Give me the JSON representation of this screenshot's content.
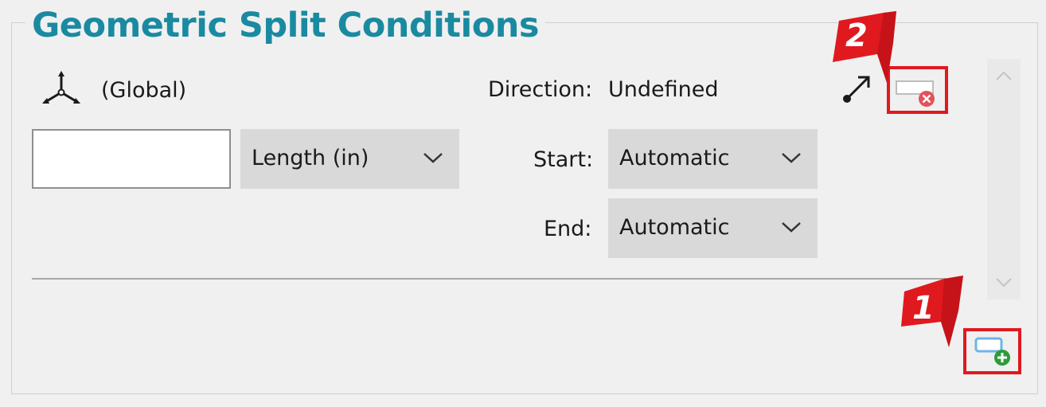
{
  "group": {
    "title": "Geometric Split Conditions"
  },
  "coordinate_system": {
    "icon": "axis-triad-icon",
    "label": "(Global)"
  },
  "direction": {
    "label": "Direction:",
    "value": "Undefined",
    "icon": "direction-arrow-icon"
  },
  "length": {
    "value": "",
    "unit_selected": "Length (in)"
  },
  "start": {
    "label": "Start:",
    "selected": "Automatic"
  },
  "end": {
    "label": "End:",
    "selected": "Automatic"
  },
  "remove_button": {
    "icon": "remove-condition-icon"
  },
  "add_button": {
    "icon": "add-condition-icon"
  },
  "callouts": [
    {
      "number": "1"
    },
    {
      "number": "2"
    }
  ],
  "colors": {
    "title": "#1a8aa1",
    "highlight": "#e0191f",
    "callout": "#e0191f",
    "add_plus": "#2e9b3a",
    "remove_x": "#e0535a"
  }
}
